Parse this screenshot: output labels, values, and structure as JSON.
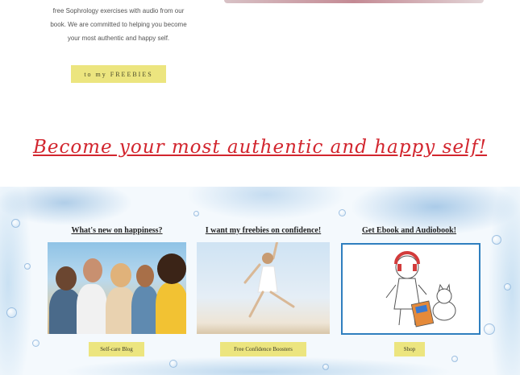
{
  "intro": {
    "line1": "free Sophrology exercises with audio from our",
    "line2": "book. We are committed  to helping you become",
    "line3": "your most authentic and happy self."
  },
  "freebies_button": "to my FREEBIES",
  "tagline": "Become your most authentic and happy self!",
  "columns": [
    {
      "title": "What's new on happiness?",
      "button": "Self-care Blog"
    },
    {
      "title": "I want my freebies on confidence!",
      "button": "Free Confidence Boosters"
    },
    {
      "title": "Get Ebook and Audiobook!",
      "button": "Shop"
    }
  ],
  "colors": {
    "accent_button": "#ece57f",
    "tagline_red": "#d2252e",
    "frame_blue": "#2f7fbf"
  }
}
